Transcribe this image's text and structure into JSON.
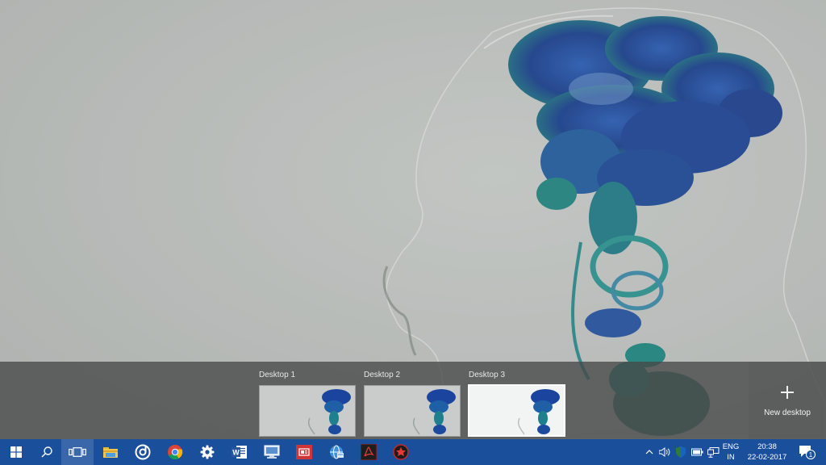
{
  "desktops": [
    {
      "label": "Desktop 1",
      "active": false
    },
    {
      "label": "Desktop 2",
      "active": false
    },
    {
      "label": "Desktop 3",
      "active": true
    }
  ],
  "new_desktop": {
    "label": "New desktop"
  },
  "taskbar": {
    "pinned": [
      {
        "name": "start-icon"
      },
      {
        "name": "search-icon"
      },
      {
        "name": "task-view-icon"
      },
      {
        "name": "file-explorer-icon"
      },
      {
        "name": "groove-music-icon"
      },
      {
        "name": "chrome-icon"
      },
      {
        "name": "settings-icon"
      },
      {
        "name": "word-icon"
      },
      {
        "name": "network-app-icon"
      },
      {
        "name": "news-app-icon"
      },
      {
        "name": "globe-app-icon"
      },
      {
        "name": "acrobat-icon"
      },
      {
        "name": "red-app-icon"
      }
    ],
    "tray": {
      "language_top": "ENG",
      "language_bottom": "IN",
      "time": "20:38",
      "date": "22-02-2017",
      "notification_count": "1"
    }
  },
  "colors": {
    "taskbar": "#1a4f9c",
    "ink_blue": "#1a4fa8",
    "ink_teal": "#1f8a86"
  }
}
